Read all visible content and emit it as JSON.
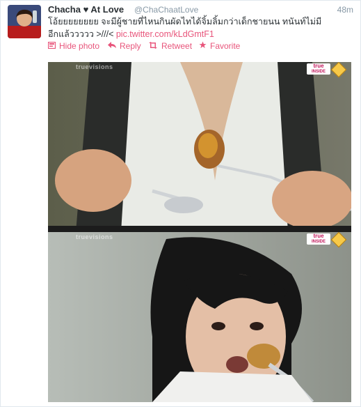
{
  "tweet": {
    "display_name": "Chacha ♥ At Love",
    "handle": "@ChaChaatLove",
    "time": "48m",
    "text_line1": "โอ้ยยยยยยยย จะมีผู้ชายที่ไหนกินผัดไทได้จิ้มลิ้มกว่าเด็กชายนน ทนันท์ไม่มี",
    "text_line2_prefix": "อีกแล้ววววว >///< ",
    "link": "pic.twitter.com/kLdGmtF1"
  },
  "actions": {
    "hide_photo": "Hide photo",
    "reply": "Reply",
    "retweet": "Retweet",
    "favorite": "Favorite"
  },
  "media": {
    "watermark_top": "truevisions",
    "logo_text": "true",
    "logo_sub": "INSIDE",
    "watermark_bottom": "truevisions"
  },
  "colors": {
    "link": "#e8557b",
    "text": "#292f33",
    "muted": "#8899a6"
  }
}
